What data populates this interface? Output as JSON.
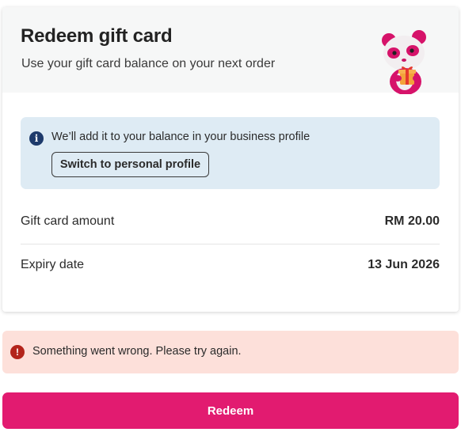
{
  "header": {
    "title": "Redeem gift card",
    "subtitle": "Use your gift card balance on your next order"
  },
  "info": {
    "text": "We’ll add it to your balance in your business profile",
    "button_label": "Switch to personal profile"
  },
  "details": [
    {
      "label": "Gift card amount",
      "value": "RM 20.00"
    },
    {
      "label": "Expiry date",
      "value": "13 Jun 2026"
    }
  ],
  "error": {
    "text": "Something went wrong. Please try again."
  },
  "actions": {
    "redeem_label": "Redeem"
  },
  "colors": {
    "brand": "#e21b70",
    "info_bg": "#deebf4",
    "error_bg": "#fde0da",
    "error_icon": "#b3241b",
    "info_icon": "#1d3a6b"
  },
  "icons": {
    "info": "info-circle-icon",
    "error": "exclamation-circle-icon",
    "mascot": "panda-gift-mascot"
  }
}
